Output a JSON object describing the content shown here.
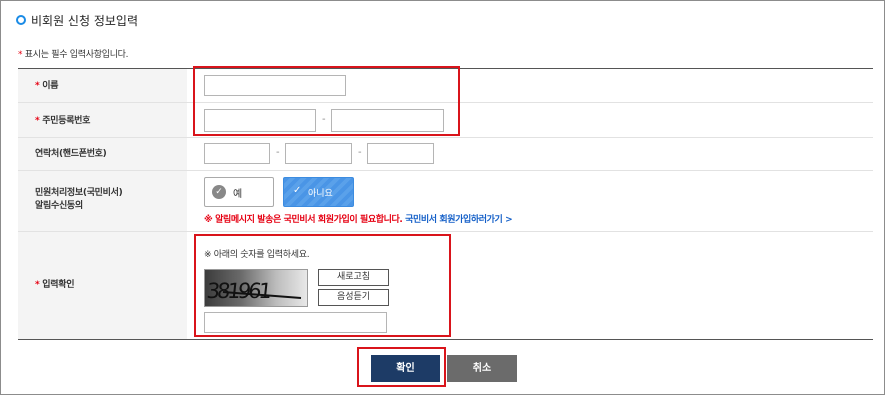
{
  "page": {
    "title": "비회원 신청 정보입력",
    "required_mark": "*",
    "required_note": "표시는 필수 입력사항입니다."
  },
  "form": {
    "name": {
      "required": true,
      "label": "이름",
      "value": ""
    },
    "rrn": {
      "required": true,
      "label": "주민등록번호",
      "separator": "-",
      "value1": "",
      "value2": ""
    },
    "phone": {
      "required": false,
      "label": "연락처(핸드폰번호)",
      "separator": "-",
      "value1": "",
      "value2": "",
      "value3": ""
    },
    "alarm": {
      "required": false,
      "label_line1": "민원처리정보(국민비서)",
      "label_line2": "알림수신동의",
      "yes_label": "예",
      "no_label": "아니요",
      "selected": "아니요",
      "notice_text": "※ 알림메시지 발송은 국민비서 회원가입이 필요합니다.",
      "notice_link": "국민비서 회원가입하러가기 >"
    },
    "captcha": {
      "required": true,
      "label": "입력확인",
      "instruction": "※ 아래의 숫자를 입력하세요.",
      "image_text": "381961",
      "refresh_label": "새로고침",
      "audio_label": "음성듣기",
      "value": ""
    }
  },
  "actions": {
    "confirm_label": "확인",
    "cancel_label": "취소"
  },
  "colors": {
    "required": "#e60012",
    "confirm_bg": "#1d3b66",
    "cancel_bg": "#6b6b6b",
    "selected_option": "#4a95e6",
    "highlight": "#d9141b",
    "link": "#1560c8"
  }
}
